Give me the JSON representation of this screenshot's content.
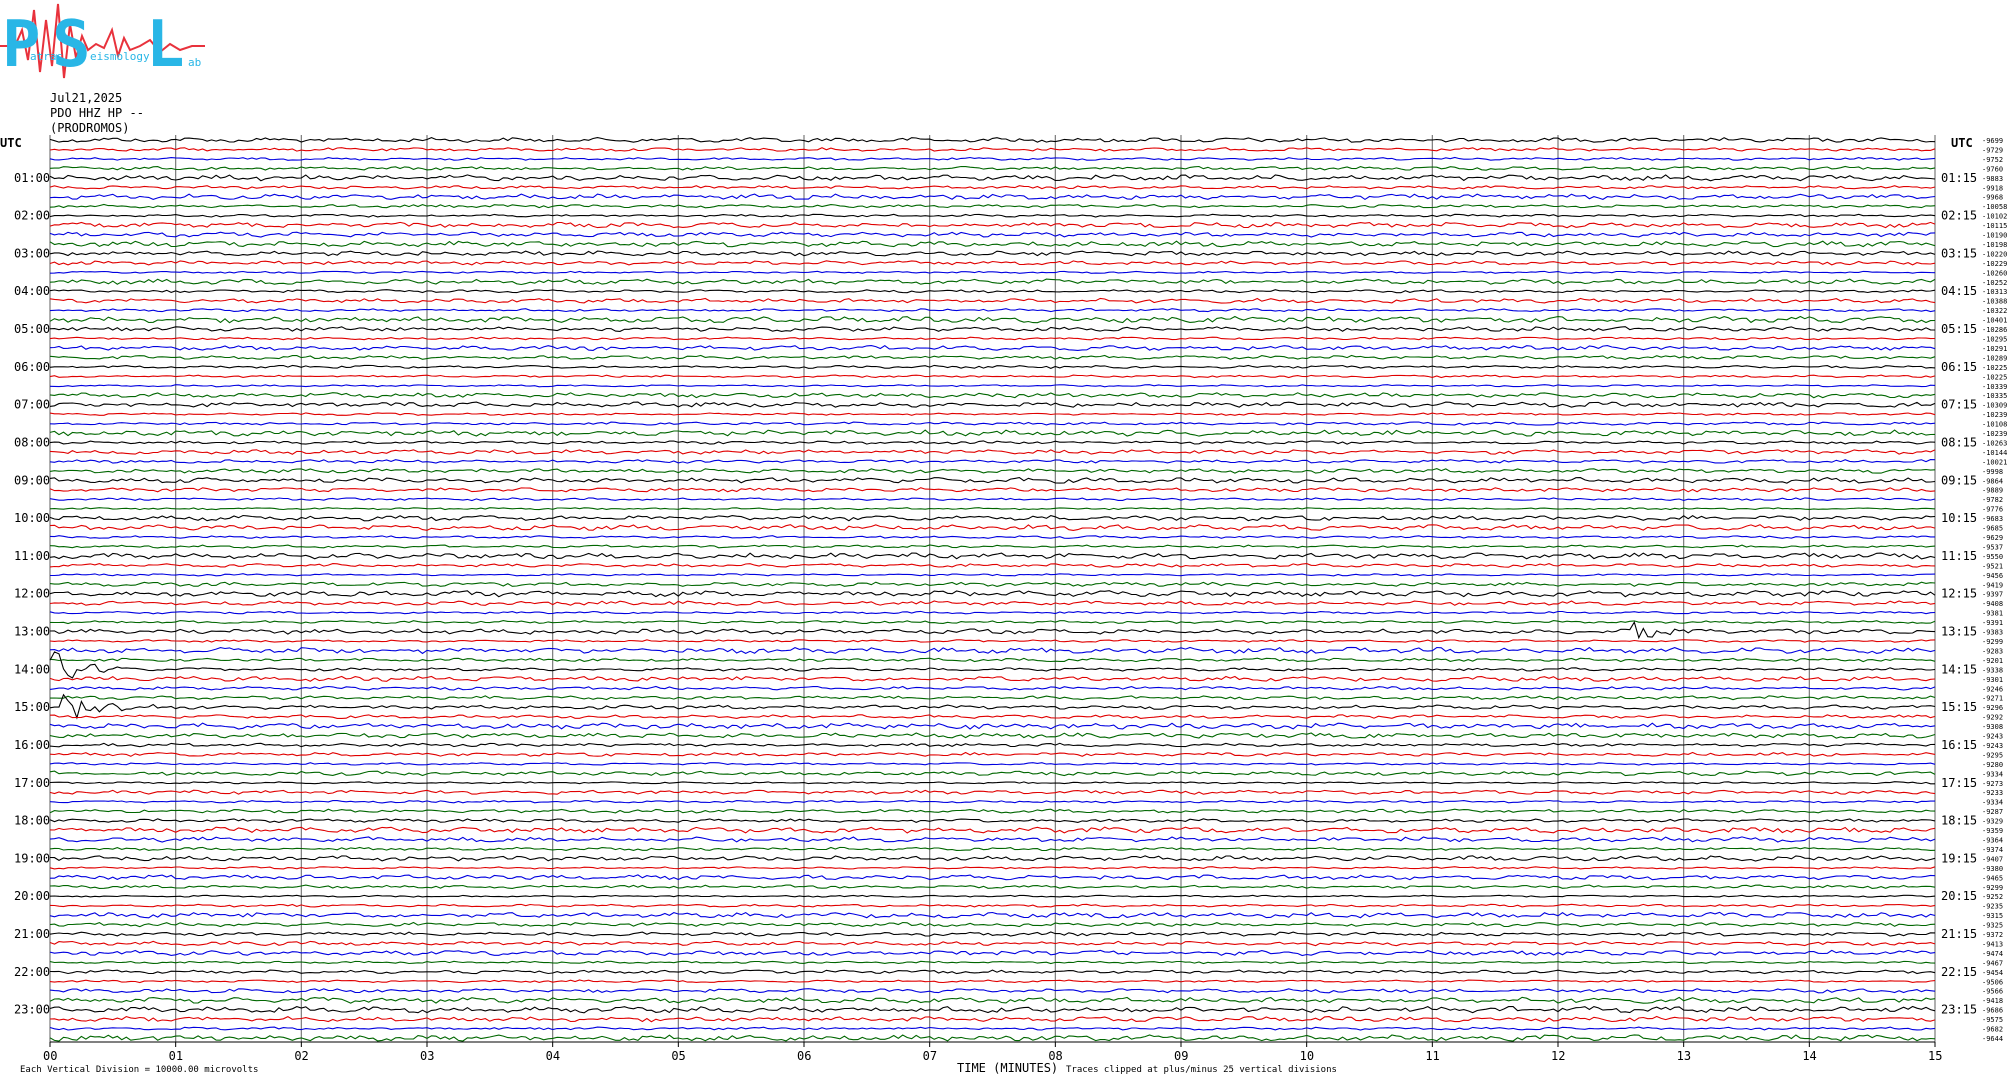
{
  "logo": {
    "letters": [
      "P",
      "S",
      "L"
    ],
    "small_words": [
      "atras",
      "eismology",
      "ab"
    ],
    "colors": {
      "letters": "#29b6e6",
      "wave": "#e8323c"
    }
  },
  "header": {
    "date": "Jul21,2025",
    "station": "PDO HHZ HP --",
    "location": "(PRODROMOS)"
  },
  "chart_data": {
    "type": "line",
    "title": "",
    "xlabel": "TIME (MINUTES)",
    "x_ticks": [
      "00",
      "01",
      "02",
      "03",
      "04",
      "05",
      "06",
      "07",
      "08",
      "09",
      "10",
      "11",
      "12",
      "13",
      "14",
      "15"
    ],
    "xlim": [
      0,
      15
    ],
    "utc_label_left": "UTC",
    "utc_label_right": "UTC",
    "hours_left": [
      "01:00",
      "02:00",
      "03:00",
      "04:00",
      "05:00",
      "06:00",
      "07:00",
      "08:00",
      "09:00",
      "10:00",
      "11:00",
      "12:00",
      "13:00",
      "14:00",
      "15:00",
      "16:00",
      "17:00",
      "18:00",
      "19:00",
      "20:00",
      "21:00",
      "22:00",
      "23:00"
    ],
    "hours_right": [
      "01:15",
      "02:15",
      "03:15",
      "04:15",
      "05:15",
      "06:15",
      "07:15",
      "08:15",
      "09:15",
      "10:15",
      "11:15",
      "12:15",
      "13:15",
      "14:15",
      "15:15",
      "16:15",
      "17:15",
      "18:15",
      "19:15",
      "20:15",
      "21:15",
      "22:15",
      "23:15"
    ],
    "trace_colors": [
      "#000000",
      "#e00000",
      "#0000e0",
      "#006600"
    ],
    "offsets": [
      "-9699",
      "-9729",
      "-9752",
      "-9760",
      "-9883",
      "-9918",
      "-9968",
      "-10058",
      "-10102",
      "-10115",
      "-10190",
      "-10198",
      "-10220",
      "-10229",
      "-10260",
      "-10252",
      "-10313",
      "-10388",
      "-10322",
      "-10401",
      "-10286",
      "-10295",
      "-10291",
      "-10289",
      "-10225",
      "-10225",
      "-10339",
      "-10335",
      "-10309",
      "-10239",
      "-10108",
      "-10239",
      "-10263",
      "-10144",
      "-10021",
      "-9998",
      "-9864",
      "-9889",
      "-9782",
      "-9776",
      "-9683",
      "-9685",
      "-9629",
      "-9537",
      "-9550",
      "-9521",
      "-9456",
      "-9419",
      "-9397",
      "-9408",
      "-9381",
      "-9391",
      "-9383",
      "-9299",
      "-9283",
      "-9201",
      "-9338",
      "-9301",
      "-9246",
      "-9271",
      "-9296",
      "-9292",
      "-9308",
      "-9243",
      "-9243",
      "-9295",
      "-9280",
      "-9334",
      "-9273",
      "-9233",
      "-9334",
      "-9287",
      "-9329",
      "-9359",
      "-9364",
      "-9374",
      "-9407",
      "-9380",
      "-9465",
      "-9299",
      "-9252",
      "-9235",
      "-9315",
      "-9325",
      "-9372",
      "-9413",
      "-9474",
      "-9467",
      "-9454",
      "-9506",
      "-9566",
      "-9418",
      "-9686",
      "-9575",
      "-9682",
      "-9644"
    ],
    "events": [
      {
        "time": "14:00",
        "minute": 0.0,
        "color": "black",
        "strength": "large"
      },
      {
        "time": "15:00",
        "minute": 0.1,
        "color": "black",
        "strength": "large"
      },
      {
        "time": "13:00",
        "minute": 12.6,
        "color": "red",
        "strength": "medium"
      }
    ],
    "footer_left": "Each Vertical Division = 10000.00 microvolts",
    "footer_right": "Traces clipped at plus/minus 25 vertical divisions"
  }
}
